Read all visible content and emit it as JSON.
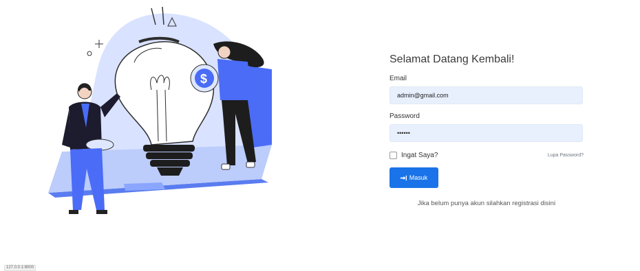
{
  "login": {
    "title": "Selamat Datang Kembali!",
    "email_label": "Email",
    "email_value": "admin@gmail.com",
    "password_label": "Password",
    "password_value": "••••••",
    "remember_label": "Ingat Saya?",
    "forgot_label": "Lupa Password?",
    "submit_label": "Masuk",
    "register_text": "Jika belum punya akun silahkan registrasi disini"
  },
  "status_url": "127.0.0.1:8000",
  "colors": {
    "accent": "#1a73e8",
    "input_bg": "#e8f0fe",
    "illustration_blue": "#4a6cf7",
    "illustration_light": "#c9d6ff"
  },
  "icons": {
    "submit": "sign-in-icon",
    "illustration": "lightbulb-money-illustration"
  }
}
